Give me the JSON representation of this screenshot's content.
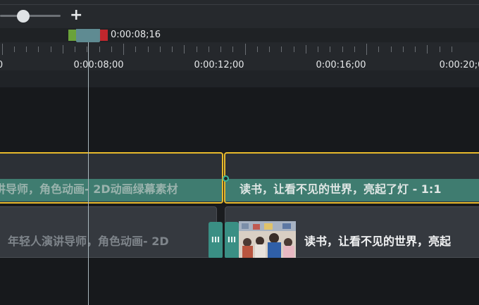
{
  "zoom": {
    "plus_label": "+",
    "zoom_level": 0.38
  },
  "playhead": {
    "time": "0:00:08;16"
  },
  "ruler": {
    "labels": [
      "0",
      "0:00:08;00",
      "0:00:12;00",
      "0:00:16;00",
      "0:00:20;0"
    ]
  },
  "track1": {
    "clips": [
      {
        "title": "讲导师，角色动画- 2D动画绿幕素材"
      },
      {
        "title": "读书，让看不见的世界，亮起了灯 - 1:1"
      }
    ]
  },
  "track2": {
    "clips": [
      {
        "title": "年轻人演讲导师，角色动画- 2D"
      },
      {
        "title": "读书，让看不见的世界，亮起"
      }
    ],
    "transition_glyph": "III"
  },
  "colors": {
    "selected_border": "#e8b92c",
    "waveform": "#3f7c70",
    "transition": "#3a8f84",
    "in_marker": "#6aa23a",
    "out_marker": "#c0272d",
    "playhead": "#5f8b92"
  },
  "icons": [
    "zoom-slider-handle",
    "plus-icon",
    "playhead-icon",
    "keyframe-icon",
    "transition-icon"
  ]
}
